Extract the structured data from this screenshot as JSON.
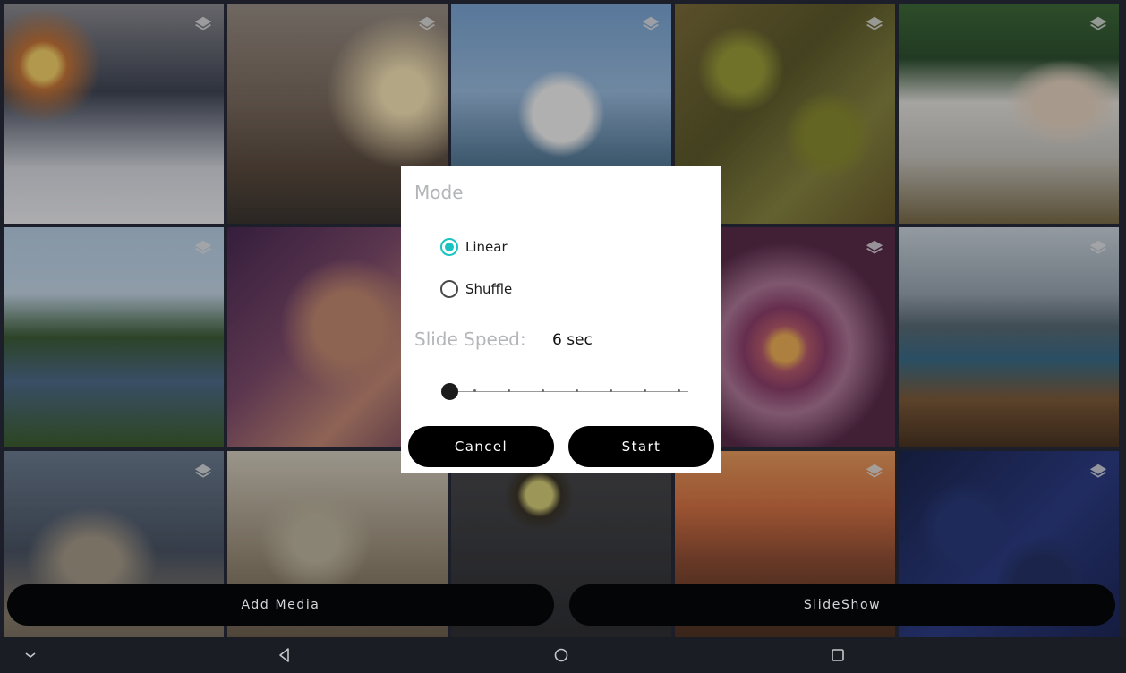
{
  "gallery": {
    "tiles": [
      {
        "label": "photo-snowy-tree-sunset"
      },
      {
        "label": "photo-boots-on-rooftop"
      },
      {
        "label": "photo-seagull-by-sea"
      },
      {
        "label": "photo-pistachios"
      },
      {
        "label": "photo-woman-on-balcony"
      },
      {
        "label": "photo-castle-with-moat"
      },
      {
        "label": "photo-man-with-glasses"
      },
      {
        "label": "photo-hidden-behind-dialog"
      },
      {
        "label": "photo-protea-flower"
      },
      {
        "label": "photo-lake-with-boat"
      },
      {
        "label": "photo-bronze-statue"
      },
      {
        "label": "photo-dinosaur-skull"
      },
      {
        "label": "photo-grey-cat"
      },
      {
        "label": "photo-desert-cactus"
      },
      {
        "label": "photo-blueberries"
      }
    ]
  },
  "actions": {
    "add_media": "Add Media",
    "slideshow": "SlideShow"
  },
  "dialog": {
    "title": "Mode",
    "options": [
      {
        "label": "Linear",
        "selected": true
      },
      {
        "label": "Shuffle",
        "selected": false
      }
    ],
    "speed_label": "Slide Speed:",
    "speed_value": "6 sec",
    "slider_position": 0,
    "slider_steps": 8,
    "cancel_label": "Cancel",
    "start_label": "Start",
    "accent_color": "#19c4c0"
  },
  "navbar": {
    "icons": [
      "chevron-down-icon",
      "back-icon",
      "home-icon",
      "recents-icon"
    ]
  }
}
